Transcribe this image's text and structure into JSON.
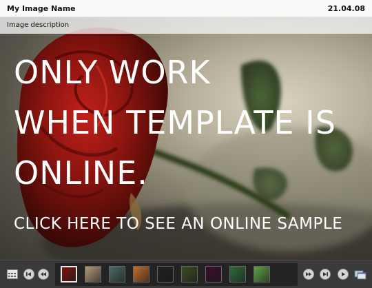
{
  "header": {
    "title": "My Image Name",
    "date": "21.04.08"
  },
  "image": {
    "description": "Image description"
  },
  "overlay": {
    "lines": [
      "ONLY WORK",
      "WHEN TEMPLATE IS",
      "ONLINE."
    ],
    "cta": "CLICK HERE TO SEE AN ONLINE SAMPLE"
  },
  "navbar": {
    "buttons": [
      "grid-view-icon",
      "skip-to-first-icon",
      "rewind-icon",
      "fast-forward-icon",
      "skip-to-last-icon",
      "play-icon",
      "window-icon"
    ],
    "thumbnails": [
      {
        "name": "red-rose",
        "color": "#7a1410",
        "selected": true
      },
      {
        "name": "figure",
        "color": "#b59b7b",
        "selected": false
      },
      {
        "name": "teal",
        "color": "#4a6b66",
        "selected": false
      },
      {
        "name": "orange-sky",
        "color": "#c46e2a",
        "selected": false
      },
      {
        "name": "dark",
        "color": "#1e2122",
        "selected": false
      },
      {
        "name": "frog",
        "color": "#3b4d22",
        "selected": false
      },
      {
        "name": "pink-flower",
        "color": "#3a0e2e",
        "selected": false
      },
      {
        "name": "green-leaf",
        "color": "#2f6b3c",
        "selected": false
      },
      {
        "name": "green-grass",
        "color": "#5fa347",
        "selected": false
      }
    ]
  },
  "colors": {
    "topbar": "#fafafa",
    "navbar": "#3a3a3a",
    "text_overlay": "#ffffff"
  }
}
